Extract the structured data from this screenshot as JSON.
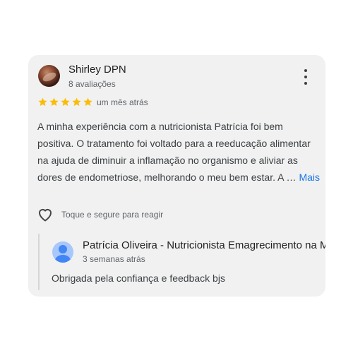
{
  "review": {
    "author": "Shirley DPN",
    "author_meta": "8 avaliações",
    "rating": 5,
    "rating_max": 5,
    "star_color": "#fbbc04",
    "date": "um mês atrás",
    "text": "A minha experiência com a nutricionista Patrícia foi bem positiva. O tratamento foi voltado para a reeducação alimentar na ajuda de diminuir a inflamação no organismo e aliviar as dores de endometriose, melhorando o meu bem estar. A …",
    "more_label": "Mais",
    "more_color": "#1a73e8",
    "menu_icon": "more-vert-icon",
    "react_icon": "heart-outline-icon",
    "react_label": "Toque e segure para reagir"
  },
  "owner_reply": {
    "name": "Patrícia Oliveira - Nutricionista Emagrecimento na M",
    "date": "3 semanas atrás",
    "text": "Obrigada pela confiança e feedback bjs",
    "avatar_icon": "person-avatar-icon"
  }
}
